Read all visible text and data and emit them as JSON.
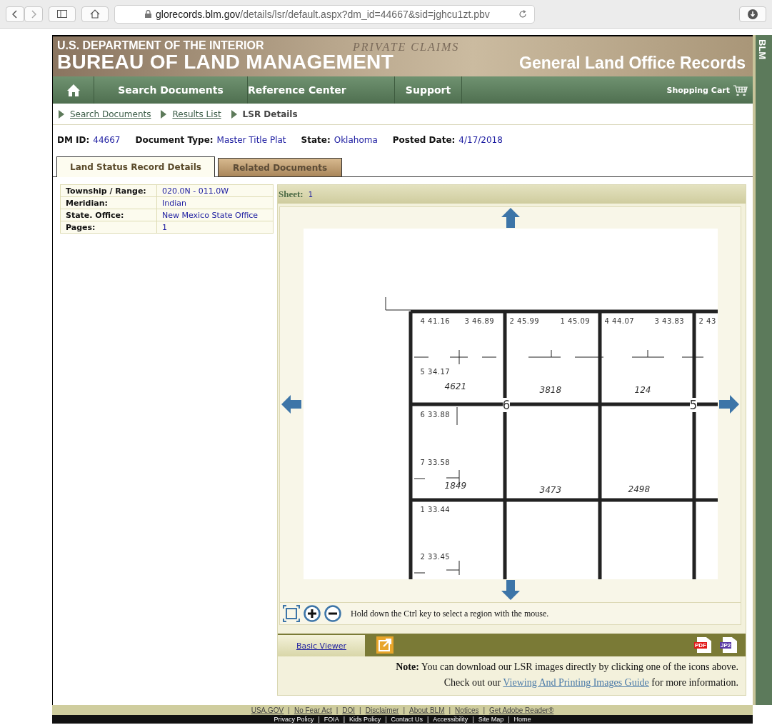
{
  "browser": {
    "url_host": "glorecords.blm.gov",
    "url_path": "/details/lsr/default.aspx?dm_id=44667&sid=jghcu1zt.pbv"
  },
  "header": {
    "agency": "U.S. DEPARTMENT OF THE INTERIOR",
    "bureau": "BUREAU OF LAND MANAGEMENT",
    "backdrop_text": "PRIVATE CLAIMS",
    "subtitle": "General Land Office Records",
    "side_tab": "BLM"
  },
  "nav": {
    "items": [
      {
        "label": "Search Documents",
        "selected": false
      },
      {
        "label": "Reference Center",
        "selected": false
      },
      {
        "label": "Support",
        "selected": false
      }
    ],
    "cart": "Shopping Cart"
  },
  "breadcrumb": [
    {
      "label": "Search Documents",
      "kind": "link"
    },
    {
      "label": "Results List",
      "kind": "link"
    },
    {
      "label": "LSR Details",
      "kind": "current"
    }
  ],
  "summary": [
    {
      "label": "DM ID:",
      "value": "44667"
    },
    {
      "label": "Document Type:",
      "value": "Master Title Plat"
    },
    {
      "label": "State:",
      "value": "Oklahoma"
    },
    {
      "label": "Posted Date:",
      "value": "4/17/2018"
    }
  ],
  "tabs": [
    {
      "label": "Land Status Record Details",
      "selected": true
    },
    {
      "label": "Related Documents",
      "selected": false
    }
  ],
  "details": [
    {
      "label": "Township / Range:",
      "value": "020.0N - 011.0W"
    },
    {
      "label": "Meridian:",
      "value": "Indian"
    },
    {
      "label": "State. Office:",
      "value": "New Mexico State Office"
    },
    {
      "label": "Pages:",
      "value": "1"
    }
  ],
  "viewer": {
    "sheet_label": "Sheet:",
    "sheet_value": "1",
    "plat": {
      "top_lots": [
        "4 41.16",
        "3 46.89",
        "2 45.99",
        "1 45.09",
        "4 44.07",
        "3 43.83",
        "2 43"
      ],
      "side_lots": [
        "5 34.17",
        "6 33.88",
        "7 33.58",
        "1 33.44",
        "2 33.45"
      ],
      "acreages": [
        "4621",
        "3818",
        "124",
        "1849",
        "3473",
        "2498"
      ],
      "sections": [
        "6",
        "5"
      ]
    },
    "hint": "Hold down the Ctrl key to select a region with the mouse.",
    "viewer_tabs": [
      {
        "label": "Basic Viewer",
        "selected": true
      }
    ],
    "downloads": [
      {
        "label": "PDF",
        "color": "#e21a1a"
      },
      {
        "label": "JP2",
        "color": "#5b3aa6"
      }
    ],
    "note_label": "Note:",
    "note": "You can download our LSR images directly by clicking one of the icons above.",
    "guide_prefix": "Check out our",
    "guide_link": "Viewing And Printing Images Guide",
    "guide_suffix": "for more information."
  },
  "footer": {
    "separator": "|",
    "links": [
      "USA.GOV",
      "No Fear Act",
      "DOI",
      "Disclaimer",
      "About BLM",
      "Notices",
      "Get Adobe Reader®"
    ],
    "links_2": [
      "Privacy Policy",
      "FOIA",
      "Kids Policy",
      "Contact Us",
      "Accessibility",
      "Site Map",
      "Home"
    ]
  }
}
